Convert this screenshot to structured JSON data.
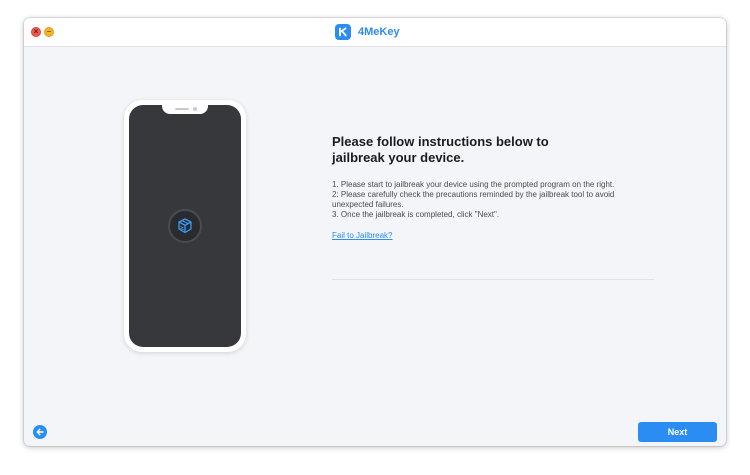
{
  "window": {
    "app_name": "4MeKey",
    "logo_letter": "K",
    "close_glyph": "×",
    "minimize_glyph": "–"
  },
  "colors": {
    "accent": "#2b8df1",
    "window_bg": "#f4f5f9",
    "phone_screen": "#37383c"
  },
  "icons": {
    "app_logo": "4mekey-logo-icon",
    "jailbreak": "jailbreak-box-icon",
    "back": "arrow-left-icon"
  },
  "main": {
    "heading": "Please follow instructions below to jailbreak your device.",
    "steps": [
      "1. Please start to jailbreak your device using the prompted program on the right.",
      "2: Please carefully check the precautions reminded by the jailbreak tool to avoid unexpected failures.",
      "3. Once the jailbreak is completed, click \"Next\"."
    ],
    "fail_link": "Fail to Jailbreak?"
  },
  "footer": {
    "next_label": "Next"
  }
}
